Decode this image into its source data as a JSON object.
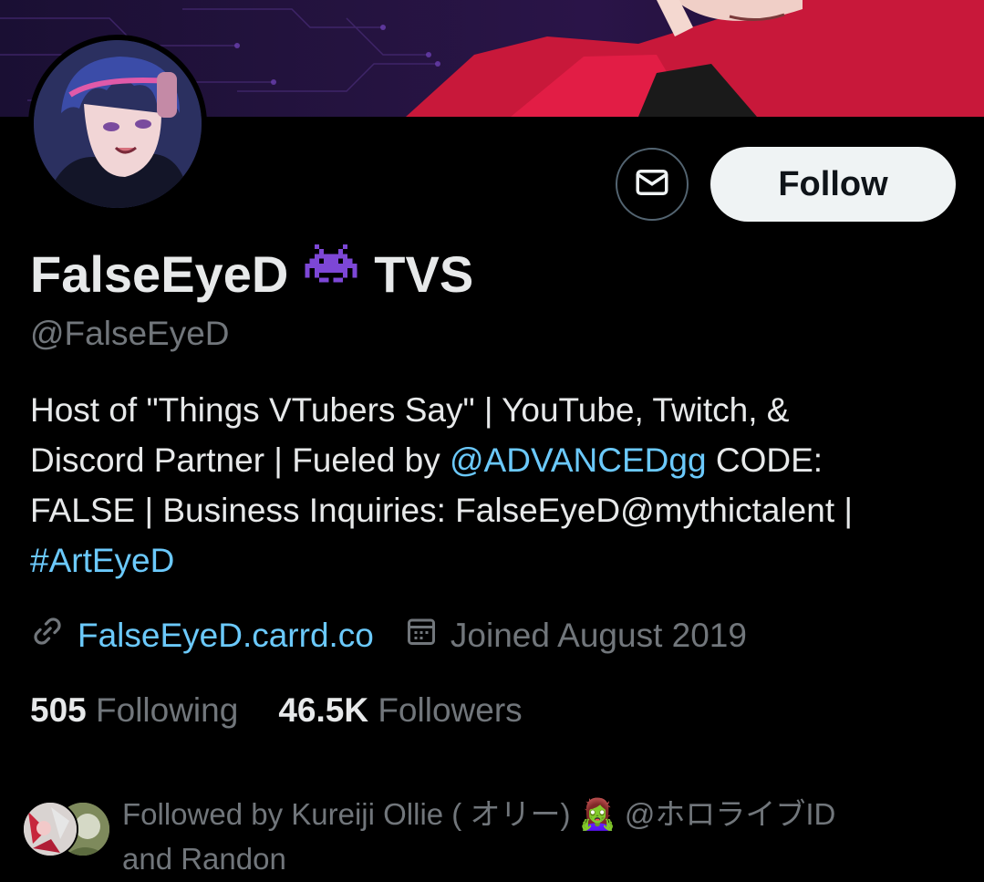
{
  "profile": {
    "display_name": "FalseEyeD",
    "name_suffix": "TVS",
    "name_emoji": "alien-monster-emoji",
    "handle": "@FalseEyeD",
    "bio": {
      "line1": "Host of \"Things VTubers Say\" | YouTube, Twitch, &",
      "line2_a": "Discord Partner | Fueled by ",
      "line2_mention": "@ADVANCEDgg",
      "line2_b": " CODE:",
      "line3": "FALSE | Business Inquiries: FalseEyeD@mythictalent |",
      "line4_hashtag": "#ArtEyeD"
    },
    "website": "FalseEyeD.carrd.co",
    "joined": "Joined August 2019"
  },
  "actions": {
    "message_icon": "envelope-icon",
    "follow_label": "Follow"
  },
  "stats": {
    "following_count": "505",
    "following_label": "Following",
    "followers_count": "46.5K",
    "followers_label": "Followers"
  },
  "followed_by": {
    "line1": "Followed by Kureiji Ollie ( オリー) 🧟‍♀️ @ホロライブID",
    "line2": "and Randon"
  },
  "colors": {
    "accent_link": "#6bc9fb",
    "secondary_text": "#71767b",
    "follow_bg": "#eff3f4",
    "emoji_purple": "#7d47d6"
  }
}
